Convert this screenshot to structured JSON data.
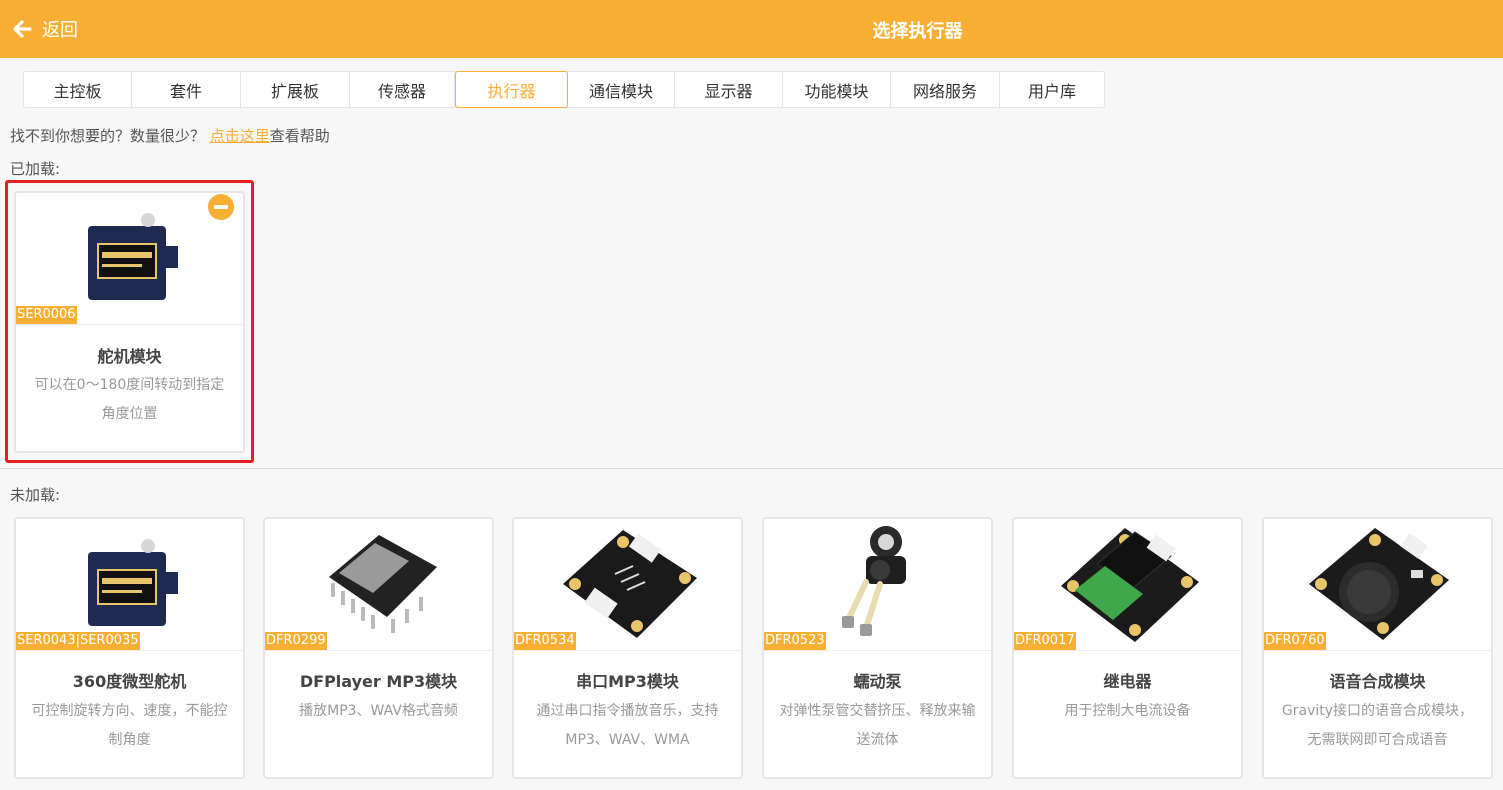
{
  "header": {
    "back_label": "返回",
    "title": "选择执行器"
  },
  "tabs": [
    {
      "label": "主控板",
      "active": false
    },
    {
      "label": "套件",
      "active": false
    },
    {
      "label": "扩展板",
      "active": false
    },
    {
      "label": "传感器",
      "active": false
    },
    {
      "label": "执行器",
      "active": true
    },
    {
      "label": "通信模块",
      "active": false
    },
    {
      "label": "显示器",
      "active": false
    },
    {
      "label": "功能模块",
      "active": false
    },
    {
      "label": "网络服务",
      "active": false
    },
    {
      "label": "用户库",
      "active": false
    }
  ],
  "help": {
    "prefix": "找不到你想要的？数量很少？ ",
    "link": "点击这里",
    "suffix": "查看帮助"
  },
  "loaded": {
    "label": "已加载:",
    "cards": [
      {
        "sku": "SER0006",
        "name": "舵机模块",
        "desc": "可以在0～180度间转动到指定角度位置",
        "image": "servo-image"
      }
    ]
  },
  "unloaded": {
    "label": "未加载:",
    "cards": [
      {
        "sku": "SER0043|SER0035",
        "name": "360度微型舵机",
        "desc": "可控制旋转方向、速度，不能控制角度",
        "image": "servo-image"
      },
      {
        "sku": "DFR0299",
        "name": "DFPlayer MP3模块",
        "desc": "播放MP3、WAV格式音频",
        "image": "mp3-module-image"
      },
      {
        "sku": "DFR0534",
        "name": "串口MP3模块",
        "desc": "通过串口指令播放音乐，支持MP3、WAV、WMA",
        "image": "serial-mp3-image"
      },
      {
        "sku": "DFR0523",
        "name": "蠕动泵",
        "desc": "对弹性泵管交替挤压、释放来输送流体",
        "image": "pump-image"
      },
      {
        "sku": "DFR0017",
        "name": "继电器",
        "desc": "用于控制大电流设备",
        "image": "relay-image"
      },
      {
        "sku": "DFR0760",
        "name": "语音合成模块",
        "desc": "Gravity接口的语音合成模块，无需联网即可合成语音",
        "image": "speech-module-image"
      }
    ]
  },
  "colors": {
    "accent": "#f9ae34",
    "highlight": "#e61e1e"
  }
}
